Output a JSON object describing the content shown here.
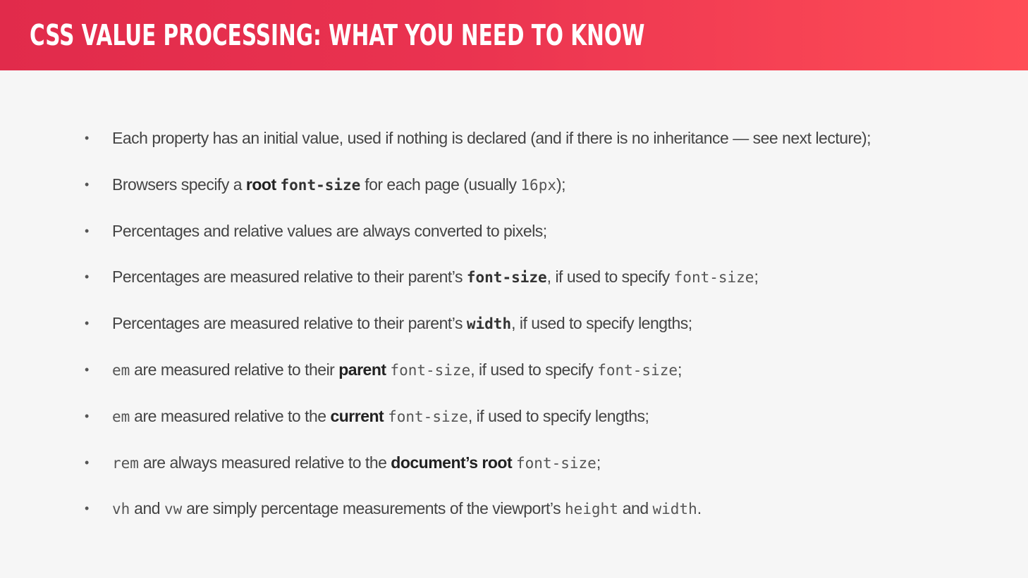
{
  "slide": {
    "title": "CSS VALUE PROCESSING: WHAT YOU NEED TO KNOW",
    "bullet_symbol": "•"
  },
  "bullets": [
    {
      "text_1": "Each property has an initial value, used if nothing is declared (and if there is no inheritance — see next lecture);"
    },
    {
      "text_1": "Browsers specify a ",
      "bold_1": "root",
      "space_1": " ",
      "code_bold_1": "font-size",
      "text_2": " for each page (usually ",
      "code_1": "16px",
      "text_3": ");"
    },
    {
      "text_1": "Percentages and relative values are always converted to pixels;"
    },
    {
      "text_1": "Percentages are measured relative to their parent’s ",
      "code_bold_1": "font-size",
      "text_2": ", if used to specify ",
      "code_1": "font-size",
      "text_3": ";"
    },
    {
      "text_1": "Percentages are measured relative to their parent’s ",
      "code_bold_1": "width",
      "text_2": ", if used to specify lengths;"
    },
    {
      "code_1": "em",
      "text_1": " are measured relative to their ",
      "bold_1": "parent",
      "space_1": " ",
      "code_2": "font-size",
      "text_2": ", if used to specify ",
      "code_3": "font-size",
      "text_3": ";"
    },
    {
      "code_1": "em",
      "text_1": " are measured relative to the ",
      "bold_1": "current",
      "space_1": " ",
      "code_2": "font-size",
      "text_2": ", if used to specify lengths;"
    },
    {
      "code_1": "rem",
      "text_1": " are always measured relative to the ",
      "bold_1": "document’s root",
      "space_1": " ",
      "code_2": "font-size",
      "text_2": ";"
    },
    {
      "code_1": "vh",
      "text_1": " and ",
      "code_2": "vw",
      "text_2": " are simply percentage measurements of the viewport’s ",
      "code_3": "height",
      "text_3": " and ",
      "code_4": "width",
      "text_4": "."
    }
  ],
  "colors": {
    "header_start": "#e12b4b",
    "header_end": "#ff4d57",
    "background": "#f6f6f6",
    "text": "#444444"
  }
}
